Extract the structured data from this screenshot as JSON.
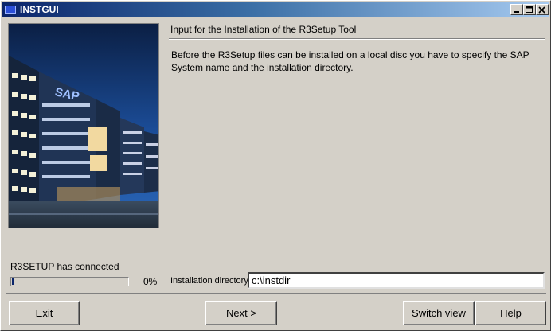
{
  "window": {
    "title": "INSTGUI"
  },
  "header": {
    "title": "Input for the Installation of the R3Setup Tool",
    "description": "Before the R3Setup files can be installed on a local disc you have to specify the SAP System name and the installation directory."
  },
  "image": {
    "logo_text": "SAP"
  },
  "status": {
    "text": "R3SETUP has connected",
    "progress_percent_label": "0%",
    "progress_value": 0.02
  },
  "form": {
    "directory_label": "Installation directory",
    "directory_value": "c:\\instdir"
  },
  "buttons": {
    "exit": "Exit",
    "next": "Next >",
    "switch_view": "Switch view",
    "help": "Help"
  },
  "colors": {
    "titlebar": "#0a246a",
    "face": "#d4d0c8"
  }
}
